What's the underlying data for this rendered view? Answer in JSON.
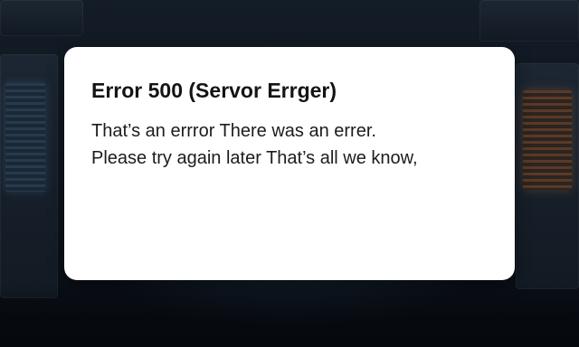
{
  "dialog": {
    "title": "Error 500 (Servor Errger)",
    "message_lines": [
      "That’s an errror There was an errer.",
      "Please try again later That’s all we know,"
    ]
  },
  "colors": {
    "background": "#0b1019",
    "dialog_background": "#ffffff",
    "text": "#141414"
  }
}
